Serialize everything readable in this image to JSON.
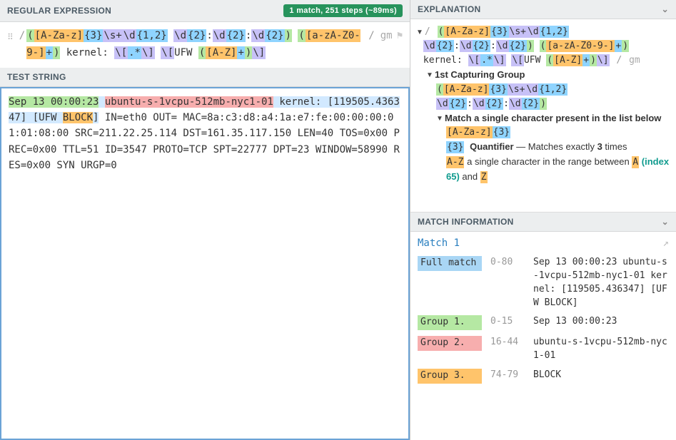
{
  "headers": {
    "regex": "REGULAR EXPRESSION",
    "test": "TEST STRING",
    "explanation": "EXPLANATION",
    "matchinfo": "MATCH INFORMATION"
  },
  "status_badge": "1 match, 251 steps (~89ms)",
  "regex": {
    "flags": "gm",
    "tokens": [
      {
        "t": "grp",
        "v": "("
      },
      {
        "t": "class",
        "v": "[A-Za-z]"
      },
      {
        "t": "quant",
        "v": "{3}"
      },
      {
        "t": "esc",
        "v": "\\s+"
      },
      {
        "t": "esc",
        "v": "\\d"
      },
      {
        "t": "quant",
        "v": "{1,2}"
      },
      {
        "t": "plain",
        "v": " "
      },
      {
        "t": "esc",
        "v": "\\d"
      },
      {
        "t": "quant",
        "v": "{2}"
      },
      {
        "t": "plain",
        "v": ":"
      },
      {
        "t": "esc",
        "v": "\\d"
      },
      {
        "t": "quant",
        "v": "{2}"
      },
      {
        "t": "plain",
        "v": ":"
      },
      {
        "t": "esc",
        "v": "\\d"
      },
      {
        "t": "quant",
        "v": "{2}"
      },
      {
        "t": "grp",
        "v": ")"
      },
      {
        "t": "plain",
        "v": " "
      },
      {
        "t": "grp",
        "v": "("
      },
      {
        "t": "class",
        "v": "[a-zA-Z0-9-]"
      },
      {
        "t": "quant",
        "v": "+"
      },
      {
        "t": "grp",
        "v": ")"
      },
      {
        "t": "plain",
        "v": " kernel: "
      },
      {
        "t": "esc",
        "v": "\\["
      },
      {
        "t": "quant",
        "v": ".*"
      },
      {
        "t": "esc",
        "v": "\\]"
      },
      {
        "t": "plain",
        "v": " "
      },
      {
        "t": "esc",
        "v": "\\["
      },
      {
        "t": "plain",
        "v": "UFW "
      },
      {
        "t": "grp",
        "v": "("
      },
      {
        "t": "class",
        "v": "[A-Z]"
      },
      {
        "t": "quant",
        "v": "+"
      },
      {
        "t": "grp",
        "v": ")"
      },
      {
        "t": "esc",
        "v": "\\]"
      }
    ]
  },
  "test_string": {
    "segments": [
      {
        "cls": "hl-g1",
        "v": "Sep 13 00:00:23"
      },
      {
        "cls": "hl-full",
        "v": " "
      },
      {
        "cls": "hl-g2",
        "v": "ubuntu-s-1vcpu-512mb-nyc1-01"
      },
      {
        "cls": "hl-full",
        "v": " kernel: [119505.436347] [UFW "
      },
      {
        "cls": "hl-g3",
        "v": "BLOCK"
      },
      {
        "cls": "hl-full",
        "v": "]"
      },
      {
        "cls": "",
        "v": " IN=eth0 OUT= MAC=8a:c3:d8:a4:1a:e7:fe:00:00:00:01:01:08:00 SRC=211.22.25.114 DST=161.35.117.150 LEN=40 TOS=0x00 PREC=0x00 TTL=51 ID=3547 PROTO=TCP SPT=22777 DPT=23 WINDOW=58990 RES=0x00 SYN URGP=0"
      }
    ]
  },
  "explanation": {
    "root_flags": "gm",
    "group1_label": "1st Capturing Group",
    "group1_pattern_tokens": [
      {
        "t": "grp",
        "v": "("
      },
      {
        "t": "class",
        "v": "[A-Za-z]"
      },
      {
        "t": "quant",
        "v": "{3}"
      },
      {
        "t": "esc",
        "v": "\\s+"
      },
      {
        "t": "esc",
        "v": "\\d"
      },
      {
        "t": "quant",
        "v": "{1,2}"
      },
      {
        "t": "plain",
        "v": " "
      },
      {
        "t": "esc",
        "v": "\\d"
      },
      {
        "t": "quant",
        "v": "{2}"
      },
      {
        "t": "plain",
        "v": ":"
      },
      {
        "t": "esc",
        "v": "\\d"
      },
      {
        "t": "quant",
        "v": "{2}"
      },
      {
        "t": "plain",
        "v": ":"
      },
      {
        "t": "esc",
        "v": "\\d"
      },
      {
        "t": "quant",
        "v": "{2}"
      },
      {
        "t": "grp",
        "v": ")"
      }
    ],
    "match_single_label": "Match a single character present in the list below",
    "charclass_tokens": [
      {
        "t": "class",
        "v": "[A-Za-z]"
      },
      {
        "t": "quant",
        "v": "{3}"
      }
    ],
    "quant_token": "{3}",
    "quant_word": "Quantifier",
    "quant_desc1": " — Matches exactly ",
    "quant_num": "3",
    "quant_desc2": " times",
    "range_token": "A-Z",
    "range_desc1": " a single character in the range between ",
    "range_a": "A",
    "range_idx_open": " (index 65)",
    "range_and": " and ",
    "range_z": "Z"
  },
  "match_info": {
    "title": "Match 1",
    "rows": [
      {
        "label": "Full match",
        "cls": "lbl-full",
        "range": "0-80",
        "value": "Sep 13 00:00:23 ubuntu-s-1vcpu-512mb-nyc1-01 kernel: [119505.436347] [UFW BLOCK]"
      },
      {
        "label": "Group 1.",
        "cls": "lbl-g1",
        "range": "0-15",
        "value": "Sep 13 00:00:23"
      },
      {
        "label": "Group 2.",
        "cls": "lbl-g2",
        "range": "16-44",
        "value": "ubuntu-s-1vcpu-512mb-nyc1-01"
      },
      {
        "label": "Group 3.",
        "cls": "lbl-g3",
        "range": "74-79",
        "value": "BLOCK"
      }
    ]
  }
}
